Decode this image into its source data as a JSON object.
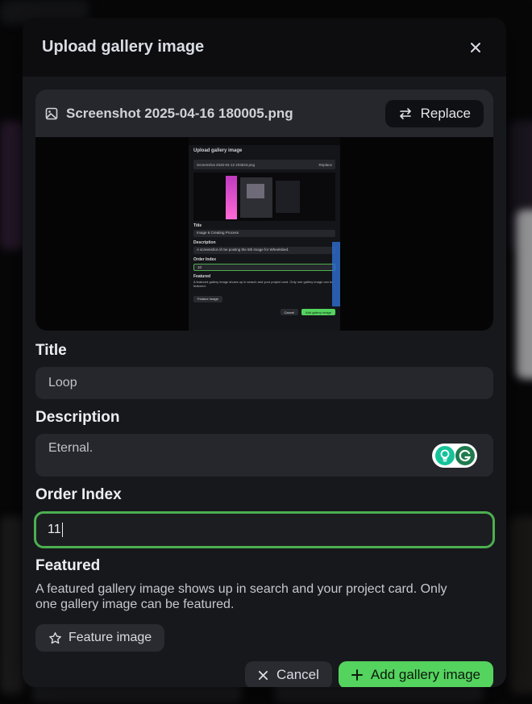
{
  "modal": {
    "title": "Upload gallery image"
  },
  "file": {
    "name": "Screenshot 2025-04-16 180005.png",
    "replace_label": "Replace"
  },
  "preview": {
    "title": "Upload gallery image",
    "file_name": "Screenshot 2025-04-12 203543.png",
    "replace_label": "Replace",
    "title_label": "Title",
    "title_value": "Image 6 Creating Process",
    "description_label": "Description",
    "description_value": "A screenshot of me posting the 6th image for Wheelsbed.",
    "order_label": "Order Index",
    "order_value": "10",
    "featured_label": "Featured",
    "featured_desc": "A featured gallery image shows up in search and your project card. Only one gallery image can be featured.",
    "feature_btn": "Feature image",
    "cancel_btn": "Cancel",
    "add_btn": "Add gallery image"
  },
  "form": {
    "title_label": "Title",
    "title_value": "Loop",
    "description_label": "Description",
    "description_value": "Eternal.",
    "order_label": "Order Index",
    "order_value": "11",
    "featured_label": "Featured",
    "featured_desc_line1": "A featured gallery image shows up in search and your project card. Only",
    "featured_desc_line2": "one gallery image can be featured.",
    "feature_button": "Feature image"
  },
  "actions": {
    "cancel": "Cancel",
    "add": "Add gallery image"
  },
  "colors": {
    "accent": "#55d35f",
    "focus_border": "#4caf50",
    "surface": "#26272c",
    "modal_bg": "#17181c"
  }
}
